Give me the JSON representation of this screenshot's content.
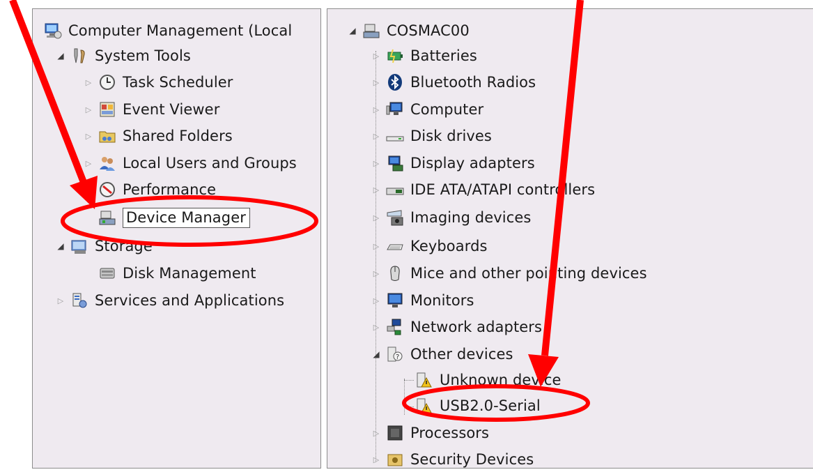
{
  "left_tree": {
    "root": "Computer Management (Local",
    "system_tools": "System Tools",
    "task_scheduler": "Task Scheduler",
    "event_viewer": "Event Viewer",
    "shared_folders": "Shared Folders",
    "local_users": "Local Users and Groups",
    "performance": "Performance",
    "device_manager": "Device Manager",
    "storage": "Storage",
    "disk_management": "Disk Management",
    "services": "Services and Applications"
  },
  "right_tree": {
    "computer_name": "COSMAC00",
    "categories": [
      "Batteries",
      "Bluetooth Radios",
      "Computer",
      "Disk drives",
      "Display adapters",
      "IDE ATA/ATAPI controllers",
      "Imaging devices",
      "Keyboards",
      "Mice and other pointing devices",
      "Monitors",
      "Network adapters",
      "Other devices"
    ],
    "other_devices_children": [
      "Unknown device",
      "USB2.0-Serial"
    ],
    "after": [
      "Processors",
      "Security Devices"
    ]
  },
  "colors": {
    "pane_bg": "#efeaf0",
    "annotation_red": "#ff0000"
  }
}
